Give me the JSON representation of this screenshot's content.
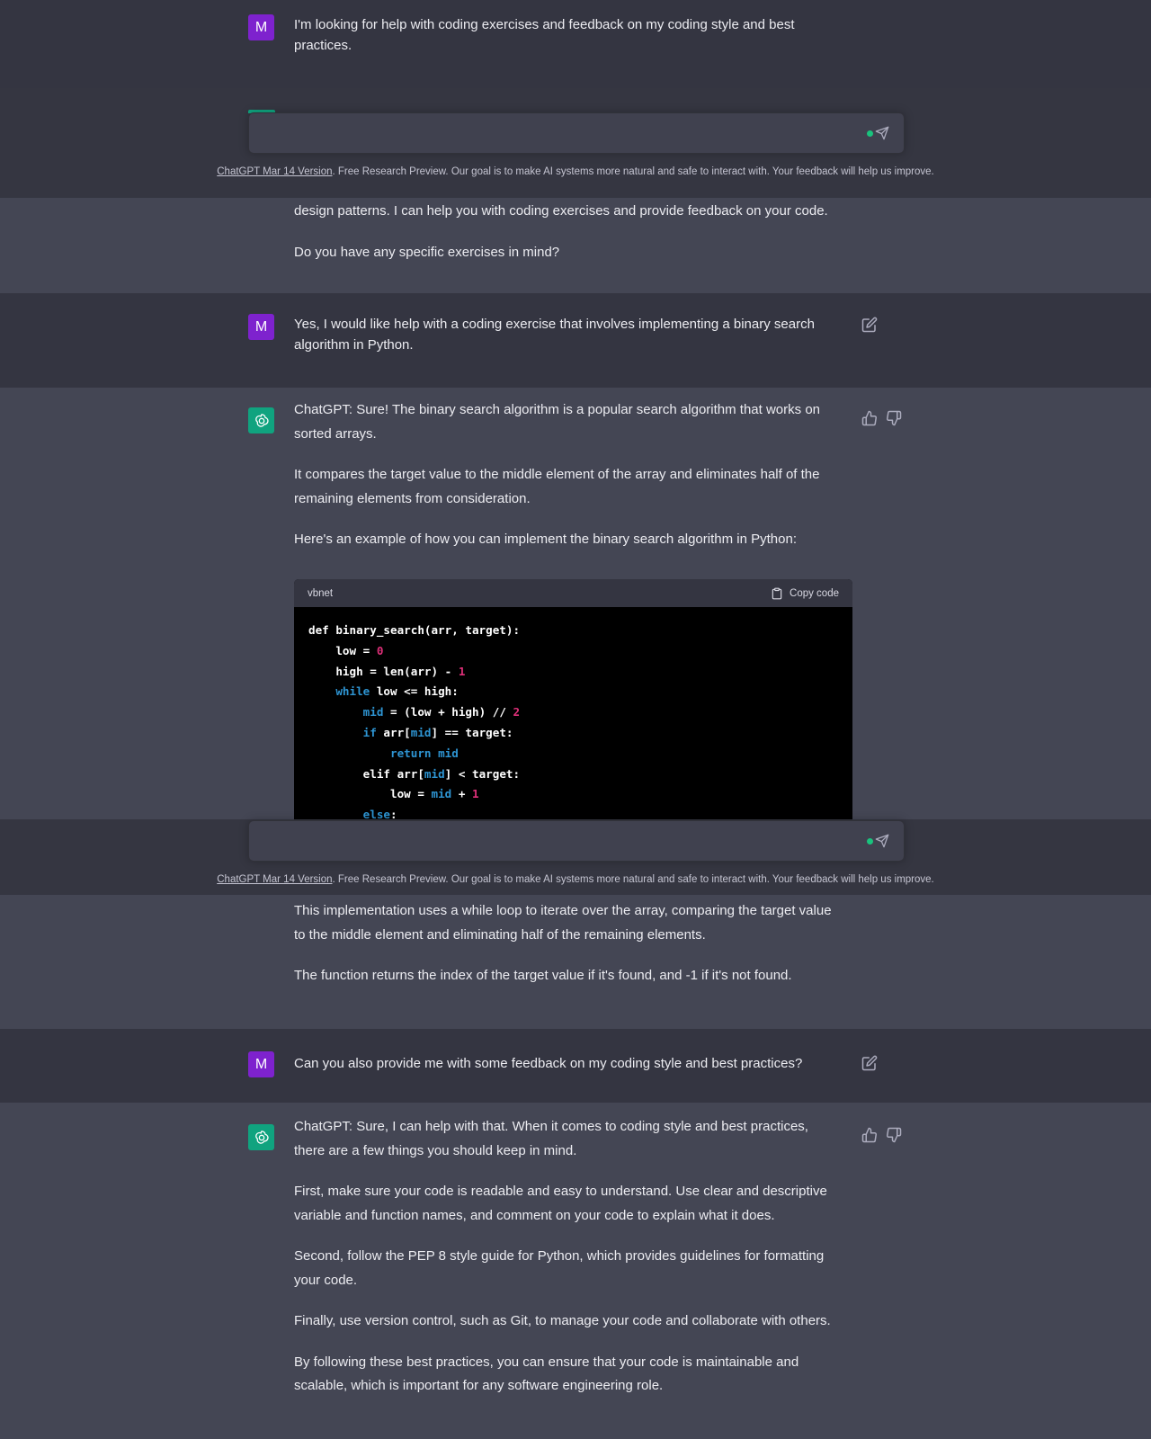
{
  "footer_note": {
    "version_link": "ChatGPT Mar 14 Version",
    "text": ". Free Research Preview. Our goal is to make AI systems more natural and safe to interact with. Your feedback will help us improve."
  },
  "user_avatar_letter": "M",
  "messages": {
    "m1": "I'm looking for help with coding exercises and feedback on my coding style and best practices.",
    "m2_p1": "design patterns. I can help you with coding exercises and provide feedback on your code.",
    "m2_p2": "Do you have any specific exercises in mind?",
    "m3": "Yes, I would like help with a coding exercise that involves implementing a binary search algorithm in Python.",
    "m4_p1": "ChatGPT: Sure! The binary search algorithm is a popular search algorithm that works on sorted arrays.",
    "m4_p2": "It compares the target value to the middle element of the array and eliminates half of the remaining elements from consideration.",
    "m4_p3": "Here's an example of how you can implement the binary search algorithm in Python:",
    "m5_p1": "This implementation uses a while loop to iterate over the array, comparing the target value to the middle element and eliminating half of the remaining elements.",
    "m5_p2": "The function returns the index of the target value if it's found, and -1 if it's not found.",
    "m6": "Can you also provide me with some feedback on my coding style and best practices?",
    "m7_p1": "ChatGPT: Sure, I can help with that. When it comes to coding style and best practices, there are a few things you should keep in mind.",
    "m7_p2": "First, make sure your code is readable and easy to understand. Use clear and descriptive variable and function names, and comment on your code to explain what it does.",
    "m7_p3": "Second, follow the PEP 8 style guide for Python, which provides guidelines for formatting your code.",
    "m7_p4": "Finally, use version control, such as Git, to manage your code and collaborate with others.",
    "m7_p5": "By following these best practices, you can ensure that your code is maintainable and scalable, which is important for any software engineering role."
  },
  "code_block": {
    "language": "vbnet",
    "copy_label": "Copy code",
    "lines": [
      "def binary_search(arr, target):",
      "    low = 0",
      "    high = len(arr) - 1",
      "    while low <= high:",
      "        mid = (low + high) // 2",
      "        if arr[mid] == target:",
      "            return mid",
      "        elif arr[mid] < target:",
      "            low = mid + 1",
      "        else:"
    ]
  },
  "icons": {
    "edit": "edit-icon",
    "thumbs_up": "thumbs-up-icon",
    "thumbs_down": "thumbs-down-icon",
    "send": "send-icon",
    "copy": "clipboard-icon",
    "bot_logo": "openai-logo-icon"
  },
  "colors": {
    "user_band": "#343541",
    "bot_band": "#444654",
    "user_avatar": "#7e22ce",
    "bot_avatar": "#10a37f",
    "code_bg": "#000000"
  }
}
